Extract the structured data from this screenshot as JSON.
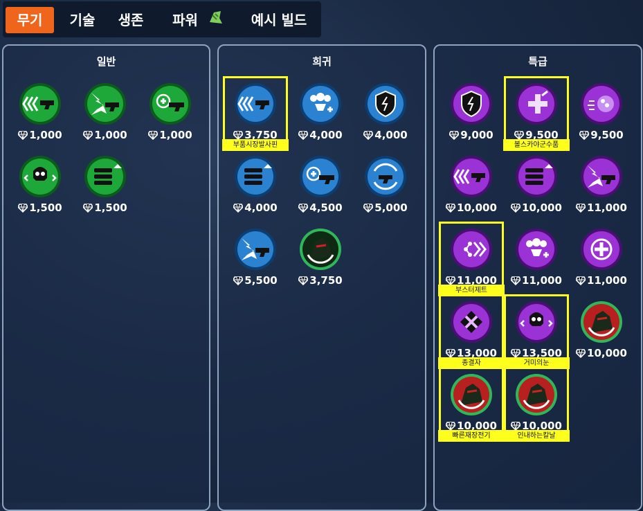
{
  "tabs": [
    "무기",
    "기술",
    "생존",
    "파워",
    "예시 빌드"
  ],
  "colors": {
    "accent": "#f0651c",
    "highlight": "#ffff1e",
    "common": "#1fa83a",
    "rare": "#2a82d1",
    "epic": "#9b32d6"
  },
  "panels": [
    {
      "title": "일반",
      "items": [
        {
          "icon": "chevron-gun-icon",
          "price": "1,000"
        },
        {
          "icon": "burst-gun-icon",
          "price": "1,000"
        },
        {
          "icon": "medkit-gun-icon",
          "price": "1,000"
        },
        {
          "icon": "skull-icon",
          "price": "1,500"
        },
        {
          "icon": "ammo-stack-icon",
          "price": "1,500"
        }
      ]
    },
    {
      "title": "희귀",
      "items": [
        {
          "icon": "chevron-gun-icon",
          "price": "3,750",
          "label": "부품시장발사핀"
        },
        {
          "icon": "team-heal-icon",
          "price": "4,000"
        },
        {
          "icon": "shield-icon",
          "price": "4,000"
        },
        {
          "icon": "ammo-stack-icon",
          "price": "4,000"
        },
        {
          "icon": "medkit-gun-icon",
          "price": "4,500"
        },
        {
          "icon": "reload-gun-icon",
          "price": "5,000"
        },
        {
          "icon": "burst-gun-icon",
          "price": "5,500"
        },
        {
          "icon": "hero-portrait-icon",
          "price": "3,750"
        }
      ]
    },
    {
      "title": "특급",
      "items": [
        {
          "icon": "shield-icon",
          "price": "9,000"
        },
        {
          "icon": "heal-plus-icon",
          "price": "9,500",
          "label": "볼스카야군수품"
        },
        {
          "icon": "orb-icon",
          "price": "9,500"
        },
        {
          "icon": "chevron-gun-icon",
          "price": "10,000"
        },
        {
          "icon": "ammo-stack-icon",
          "price": "10,000"
        },
        {
          "icon": "burst-gun-icon",
          "price": "11,000"
        },
        {
          "icon": "booster-icon",
          "price": "11,000",
          "label": "부스터제트"
        },
        {
          "icon": "team-heal-icon",
          "price": "11,000"
        },
        {
          "icon": "crosshair-icon",
          "price": "11,000"
        },
        {
          "icon": "eliminator-icon",
          "price": "13,000",
          "label": "종결자"
        },
        {
          "icon": "skull-icon",
          "price": "13,500",
          "label": "거미의눈"
        },
        {
          "icon": "hero-portrait-icon",
          "price": "10,000"
        },
        {
          "icon": "hero-portrait-icon",
          "price": "10,000",
          "label": "빠른재장전기"
        },
        {
          "icon": "hero-portrait-icon",
          "price": "10,000",
          "label": "인내하는칼날"
        }
      ]
    }
  ]
}
